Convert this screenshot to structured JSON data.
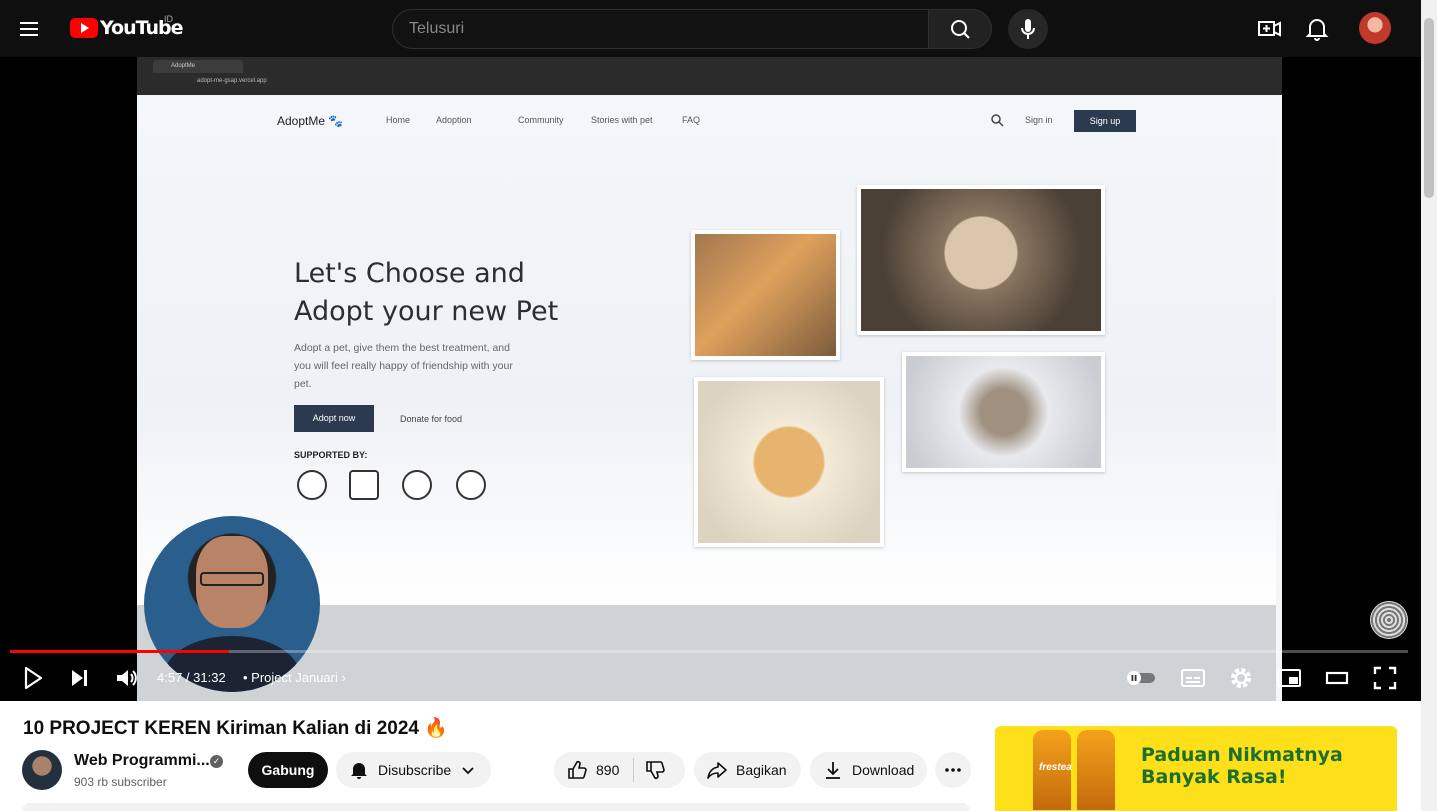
{
  "header": {
    "logo_text": "YouTube",
    "country_code": "ID",
    "search_placeholder": "Telusuri"
  },
  "video_frame": {
    "browser_tab": "AdoptMe",
    "browser_url": "adopt-me-gsap.vercel.app",
    "site": {
      "logo": "AdoptMe",
      "nav": [
        "Home",
        "Adoption",
        "Community",
        "Stories with pet",
        "FAQ"
      ],
      "sign_in": "Sign in",
      "sign_up": "Sign up",
      "hero_line1": "Let's Choose and",
      "hero_line2": "Adopt your new Pet",
      "hero_sub": "Adopt a pet, give them the best treatment, and you will feel really happy of friendship with your pet.",
      "adopt_btn": "Adopt now",
      "donate_btn": "Donate for food",
      "supported": "SUPPORTED BY:"
    }
  },
  "player": {
    "progress_fraction": 0.157,
    "time": "4:57 / 31:32",
    "chapter": "• Project Januari"
  },
  "video": {
    "title": "10 PROJECT KEREN Kiriman Kalian di 2024 🔥",
    "channel_name": "Web Programmi...",
    "subscribers": "903 rb subscriber",
    "join_label": "Gabung",
    "subscribed_label": "Disubscribe",
    "likes": "890",
    "share_label": "Bagikan",
    "download_label": "Download"
  },
  "ad": {
    "brand": "frestea",
    "line1": "Paduan Nikmatnya",
    "line2": "Banyak Rasa!"
  },
  "colors": {
    "brand_red": "#ff0000",
    "dark_bg": "#0f0f0f",
    "ad_yellow": "#fde01a"
  }
}
